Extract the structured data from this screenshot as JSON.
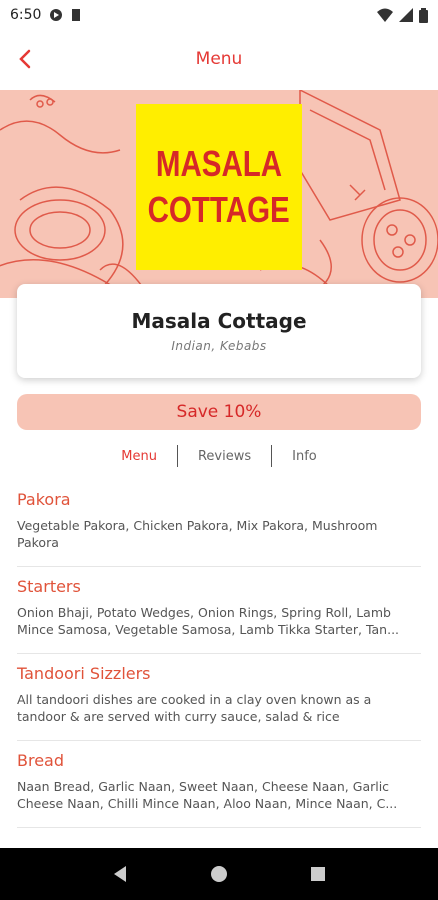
{
  "status": {
    "time": "6:50"
  },
  "app_bar": {
    "title": "Menu"
  },
  "restaurant": {
    "logo_line1": "MASALA",
    "logo_line2": "COTTAGE",
    "name": "Masala Cottage",
    "cuisine": "Indian, Kebabs",
    "offer": "Save 10%"
  },
  "tabs": [
    {
      "label": "Menu",
      "active": true
    },
    {
      "label": "Reviews",
      "active": false
    },
    {
      "label": "Info",
      "active": false
    }
  ],
  "categories": [
    {
      "title": "Pakora",
      "desc": "Vegetable Pakora, Chicken Pakora, Mix Pakora, Mushroom Pakora"
    },
    {
      "title": "Starters",
      "desc": "Onion Bhaji, Potato Wedges, Onion Rings, Spring Roll, Lamb Mince Samosa, Vegetable Samosa, Lamb Tikka Starter, Tan..."
    },
    {
      "title": "Tandoori Sizzlers",
      "desc": "All tandoori dishes are cooked in a clay oven known as a tandoor & are served with curry sauce, salad & rice"
    },
    {
      "title": "Bread",
      "desc": "Naan Bread, Garlic Naan, Sweet Naan, Cheese Naan, Garlic Cheese Naan, Chilli Mince Naan, Aloo Naan, Mince Naan, C..."
    }
  ],
  "colors": {
    "accent": "#e53935",
    "hero_bg": "#f7c4b5",
    "logo_bg": "#ffee00"
  }
}
